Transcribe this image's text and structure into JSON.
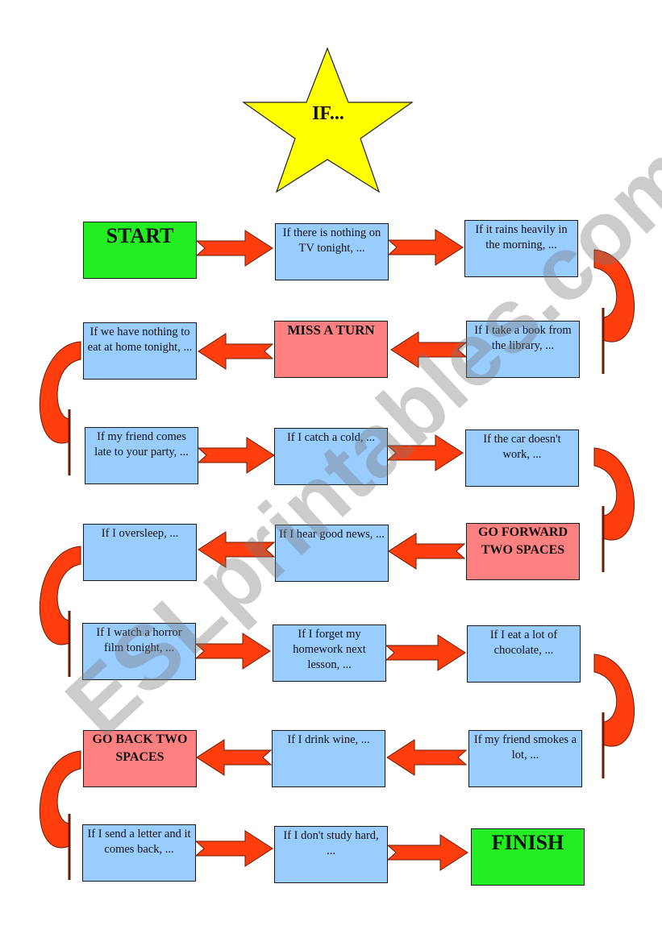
{
  "title": "IF...",
  "watermark": "ESLprintables.com",
  "colors": {
    "square": "#99ccff",
    "start_finish": "#22ee22",
    "special": "#ff8080",
    "arrow": "#ff3d0d",
    "star": "#ffff00"
  },
  "squares": [
    {
      "text": "START",
      "kind": "start"
    },
    {
      "text": "If there is nothing on TV tonight, ...",
      "kind": "normal"
    },
    {
      "text": "If it rains heavily in the morning, ...",
      "kind": "normal"
    },
    {
      "text": "If I take a book from the library, ...",
      "kind": "normal"
    },
    {
      "text": "MISS A TURN",
      "kind": "special"
    },
    {
      "text": "If we have nothing to eat at home tonight, ...",
      "kind": "normal"
    },
    {
      "text": "If my friend comes late to your party, ...",
      "kind": "normal"
    },
    {
      "text": "If I catch a cold, ...",
      "kind": "normal"
    },
    {
      "text": "If the car doesn't work, ...",
      "kind": "normal"
    },
    {
      "text": "GO FORWARD TWO SPACES",
      "kind": "special"
    },
    {
      "text": "If I hear good news, ...",
      "kind": "normal"
    },
    {
      "text": "If I oversleep, ...",
      "kind": "normal"
    },
    {
      "text": "If I watch a horror film tonight, ...",
      "kind": "normal"
    },
    {
      "text": "If I forget my homework next lesson, ...",
      "kind": "normal"
    },
    {
      "text": "If I eat a lot of chocolate, ...",
      "kind": "normal"
    },
    {
      "text": "If my friend smokes a lot, ...",
      "kind": "normal"
    },
    {
      "text": "If I drink wine, ...",
      "kind": "normal"
    },
    {
      "text": "GO BACK TWO SPACES",
      "kind": "special"
    },
    {
      "text": "If I send a letter and it comes back, ...",
      "kind": "normal"
    },
    {
      "text": "If I don't study hard, ...",
      "kind": "normal"
    },
    {
      "text": "FINISH",
      "kind": "finish"
    }
  ]
}
